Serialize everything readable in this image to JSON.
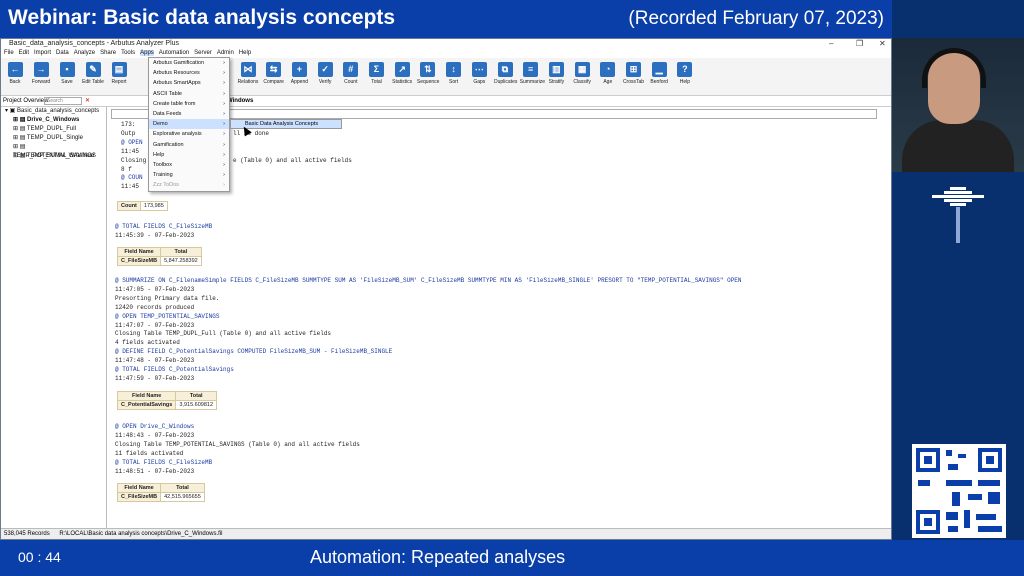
{
  "banner": {
    "title": "Webinar: Basic data analysis concepts",
    "date": "(Recorded February 07, 2023)",
    "clock": "00 : 44",
    "subtitle": "Automation: Repeated analyses"
  },
  "app": {
    "window_title": "Basic_data_analysis_concepts - Arbutus Analyzer Plus",
    "menu": [
      "File",
      "Edit",
      "Import",
      "Data",
      "Analyze",
      "Share",
      "Tools",
      "Apps",
      "Automation",
      "Server",
      "Admin",
      "Help"
    ],
    "active_menu": "Apps",
    "toolbar_left": [
      {
        "label": "Back",
        "icon": "back-arrow-icon",
        "glyph": "←"
      },
      {
        "label": "Forward",
        "icon": "forward-arrow-icon",
        "glyph": "→"
      },
      {
        "label": "Save",
        "icon": "save-icon",
        "glyph": "▪"
      },
      {
        "label": "Edit Table",
        "icon": "edit-table-icon",
        "glyph": "✎"
      },
      {
        "label": "Report",
        "icon": "report-icon",
        "glyph": "▤"
      }
    ],
    "toolbar_right": [
      {
        "label": "Relations",
        "icon": "relations-icon",
        "glyph": "⋈"
      },
      {
        "label": "Compare",
        "icon": "compare-icon",
        "glyph": "⇆"
      },
      {
        "label": "Append",
        "icon": "append-icon",
        "glyph": "+"
      },
      {
        "label": "Verify",
        "icon": "verify-icon",
        "glyph": "✓"
      },
      {
        "label": "Count",
        "icon": "count-icon",
        "glyph": "#"
      },
      {
        "label": "Total",
        "icon": "total-icon",
        "glyph": "Σ"
      },
      {
        "label": "Statistics",
        "icon": "statistics-icon",
        "glyph": "↗"
      },
      {
        "label": "Sequence",
        "icon": "sequence-icon",
        "glyph": "⇅"
      },
      {
        "label": "Sort",
        "icon": "sort-icon",
        "glyph": "↕"
      },
      {
        "label": "Gaps",
        "icon": "gaps-icon",
        "glyph": "⋯"
      },
      {
        "label": "Duplicates",
        "icon": "duplicates-icon",
        "glyph": "⧉"
      },
      {
        "label": "Summarize",
        "icon": "summarize-icon",
        "glyph": "≡"
      },
      {
        "label": "Stratify",
        "icon": "stratify-icon",
        "glyph": "▥"
      },
      {
        "label": "Classify",
        "icon": "classify-icon",
        "glyph": "▦"
      },
      {
        "label": "Age",
        "icon": "age-icon",
        "glyph": "◔"
      },
      {
        "label": "CrossTab",
        "icon": "crosstab-icon",
        "glyph": "⊞"
      },
      {
        "label": "Benford",
        "icon": "benford-icon",
        "glyph": "▁"
      },
      {
        "label": "Help",
        "icon": "help-icon",
        "glyph": "?"
      }
    ],
    "tab_label": "Windows",
    "project_overview_label": "Project Overview",
    "search_placeholder": "Search",
    "project_tree": [
      "Basic_data_analysis_concepts",
      "Drive_C_Windows",
      "TEMP_DUPL_Full",
      "TEMP_DUPL_Single",
      "TEMP_POTENTIAL_SAVINGS",
      "TEMP_SUMM_WriteYear"
    ],
    "apps_menu": [
      {
        "label": "Arbutus Gamification",
        "sub": true
      },
      {
        "label": "Arbutus Resources",
        "sub": true
      },
      {
        "label": "Arbutus SmartApps",
        "sub": true
      },
      {
        "label": "ASCII Table",
        "sub": true
      },
      {
        "label": "Create table from",
        "sub": true
      },
      {
        "label": "Data Feeds",
        "sub": true
      },
      {
        "label": "Demo",
        "sub": true,
        "selected": true
      },
      {
        "label": "Explorative analysis",
        "sub": true
      },
      {
        "label": "Gamification",
        "sub": true
      },
      {
        "label": "Help",
        "sub": true
      },
      {
        "label": "Toolbox",
        "sub": true
      },
      {
        "label": "Training",
        "sub": true
      },
      {
        "label": "Zzz ToDos",
        "sub": true,
        "disabled": true
      }
    ],
    "submenu_item": "Basic Data Analysis Concepts",
    "status_records": "538,045 Records",
    "status_path": "R:\\LOCAL\\Basic data analysis concepts\\Drive_C_Windows.fil"
  },
  "log": {
    "partial_lines": [
      "173:",
      "Outp",
      "@ OPEN",
      "11:45",
      "Closing",
      "  8 f",
      "@ COUN",
      "11:45"
    ],
    "partial_right": [
      "ll is done",
      "e (Table 0) and all active fields"
    ],
    "count_label": "Count",
    "count_value": "173,985",
    "lines_a": [
      "@ TOTAL FIELDS C_FileSizeMB",
      "11:45:39 - 07-Feb-2023"
    ],
    "t1": {
      "h1": "Field Name",
      "h2": "Total",
      "name": "C_FileSizeMB",
      "value": "5,847.258392"
    },
    "lines_b": [
      "@ SUMMARIZE ON C_FilenameSimple FIELDS C_FileSizeMB SUMMTYPE SUM AS 'FileSizeMB_SUM' C_FileSizeMB SUMMTYPE MIN AS 'FileSizeMB_SINGLE' PRESORT TO \"TEMP_POTENTIAL_SAVINGS\" OPEN",
      "11:47:05 - 07-Feb-2023",
      "Presorting Primary data file.",
      "   12420 records produced",
      "@ OPEN TEMP_POTENTIAL_SAVINGS",
      "11:47:07 - 07-Feb-2023",
      "Closing Table TEMP_DUPL_Full (Table 0) and all active fields",
      "   4 fields activated",
      "@ DEFINE FIELD C_PotentialSavings COMPUTED FileSizeMB_SUM - FileSizeMB_SINGLE",
      "11:47:48 - 07-Feb-2023",
      "@ TOTAL FIELDS C_PotentialSavings",
      "11:47:59 - 07-Feb-2023"
    ],
    "t2": {
      "h1": "Field Name",
      "h2": "Total",
      "name": "C_PotentialSavings",
      "value": "3,915.609812"
    },
    "lines_c": [
      "@ OPEN Drive_C_Windows",
      "11:48:43 - 07-Feb-2023",
      "Closing Table TEMP_POTENTIAL_SAVINGS (Table 0) and all active fields",
      "   11 fields activated",
      "@ TOTAL FIELDS C_FileSizeMB",
      "11:48:51 - 07-Feb-2023"
    ],
    "t3": {
      "h1": "Field Name",
      "h2": "Total",
      "name": "C_FileSizeMB",
      "value": "42,515.965655"
    }
  }
}
